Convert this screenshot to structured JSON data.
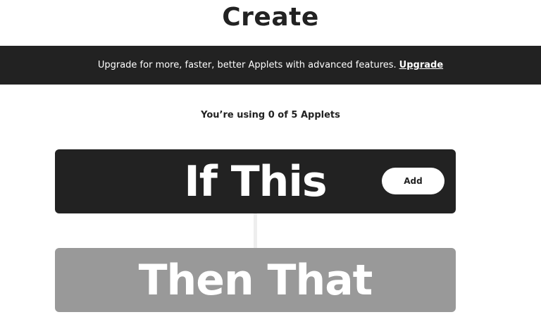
{
  "page": {
    "title": "Create"
  },
  "banner": {
    "text": "Upgrade for more, faster, better Applets with advanced features.",
    "link_label": "Upgrade"
  },
  "usage": {
    "text": "You’re using 0 of 5 Applets"
  },
  "trigger": {
    "label": "If This",
    "button_label": "Add"
  },
  "action": {
    "label": "Then That"
  },
  "colors": {
    "dark": "#222222",
    "disabled": "#999999",
    "background": "#ffffff"
  }
}
